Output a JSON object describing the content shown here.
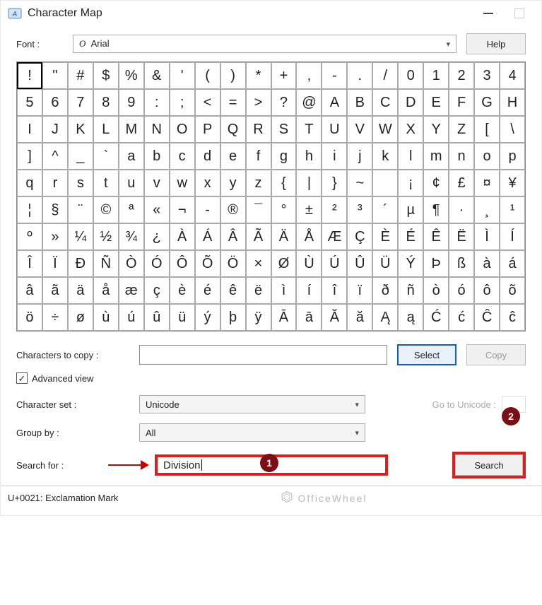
{
  "window": {
    "title": "Character Map"
  },
  "font": {
    "label": "Font :",
    "value": "Arial",
    "prefix": "O",
    "help": "Help"
  },
  "chars": [
    "!",
    "\"",
    "#",
    "$",
    "%",
    "&",
    "'",
    "(",
    ")",
    "*",
    "+",
    ",",
    "-",
    ".",
    "/",
    "0",
    "1",
    "2",
    "3",
    "4",
    "5",
    "6",
    "7",
    "8",
    "9",
    ":",
    ";",
    "<",
    "=",
    ">",
    "?",
    "@",
    "A",
    "B",
    "C",
    "D",
    "E",
    "F",
    "G",
    "H",
    "I",
    "J",
    "K",
    "L",
    "M",
    "N",
    "O",
    "P",
    "Q",
    "R",
    "S",
    "T",
    "U",
    "V",
    "W",
    "X",
    "Y",
    "Z",
    "[",
    "\\",
    "]",
    "^",
    "_",
    "`",
    "a",
    "b",
    "c",
    "d",
    "e",
    "f",
    "g",
    "h",
    "i",
    "j",
    "k",
    "l",
    "m",
    "n",
    "o",
    "p",
    "q",
    "r",
    "s",
    "t",
    "u",
    "v",
    "w",
    "x",
    "y",
    "z",
    "{",
    "|",
    "}",
    "~",
    " ",
    "¡",
    "¢",
    "£",
    "¤",
    "¥",
    "¦",
    "§",
    "¨",
    "©",
    "ª",
    "«",
    "¬",
    "-",
    "®",
    "¯",
    "°",
    "±",
    "²",
    "³",
    "´",
    "µ",
    "¶",
    "·",
    "¸",
    "¹",
    "º",
    "»",
    "¼",
    "½",
    "¾",
    "¿",
    "À",
    "Á",
    "Â",
    "Ã",
    "Ä",
    "Å",
    "Æ",
    "Ç",
    "È",
    "É",
    "Ê",
    "Ë",
    "Ì",
    "Í",
    "Î",
    "Ï",
    "Ð",
    "Ñ",
    "Ò",
    "Ó",
    "Ô",
    "Õ",
    "Ö",
    "×",
    "Ø",
    "Ù",
    "Ú",
    "Û",
    "Ü",
    "Ý",
    "Þ",
    "ß",
    "à",
    "á",
    "â",
    "ã",
    "ä",
    "å",
    "æ",
    "ç",
    "è",
    "é",
    "ê",
    "ë",
    "ì",
    "í",
    "î",
    "ï",
    "ð",
    "ñ",
    "ò",
    "ó",
    "ô",
    "õ",
    "ö",
    "÷",
    "ø",
    "ù",
    "ú",
    "û",
    "ü",
    "ý",
    "þ",
    "ÿ",
    "Ā",
    "ā",
    "Ă",
    "ă",
    "Ą",
    "ą",
    "Ć",
    "ć",
    "Ĉ",
    "ĉ"
  ],
  "selected_index": 0,
  "copy": {
    "label": "Characters to copy :",
    "select_btn": "Select",
    "copy_btn": "Copy"
  },
  "advanced": {
    "label": "Advanced view",
    "checked": true
  },
  "charset": {
    "label": "Character set :",
    "value": "Unicode",
    "goto_label": "Go to Unicode :"
  },
  "group": {
    "label": "Group by :",
    "value": "All"
  },
  "search": {
    "label": "Search for :",
    "value": "Division",
    "button": "Search"
  },
  "callouts": {
    "one": "1",
    "two": "2"
  },
  "status": "U+0021: Exclamation Mark",
  "watermark": "OfficeWheel"
}
